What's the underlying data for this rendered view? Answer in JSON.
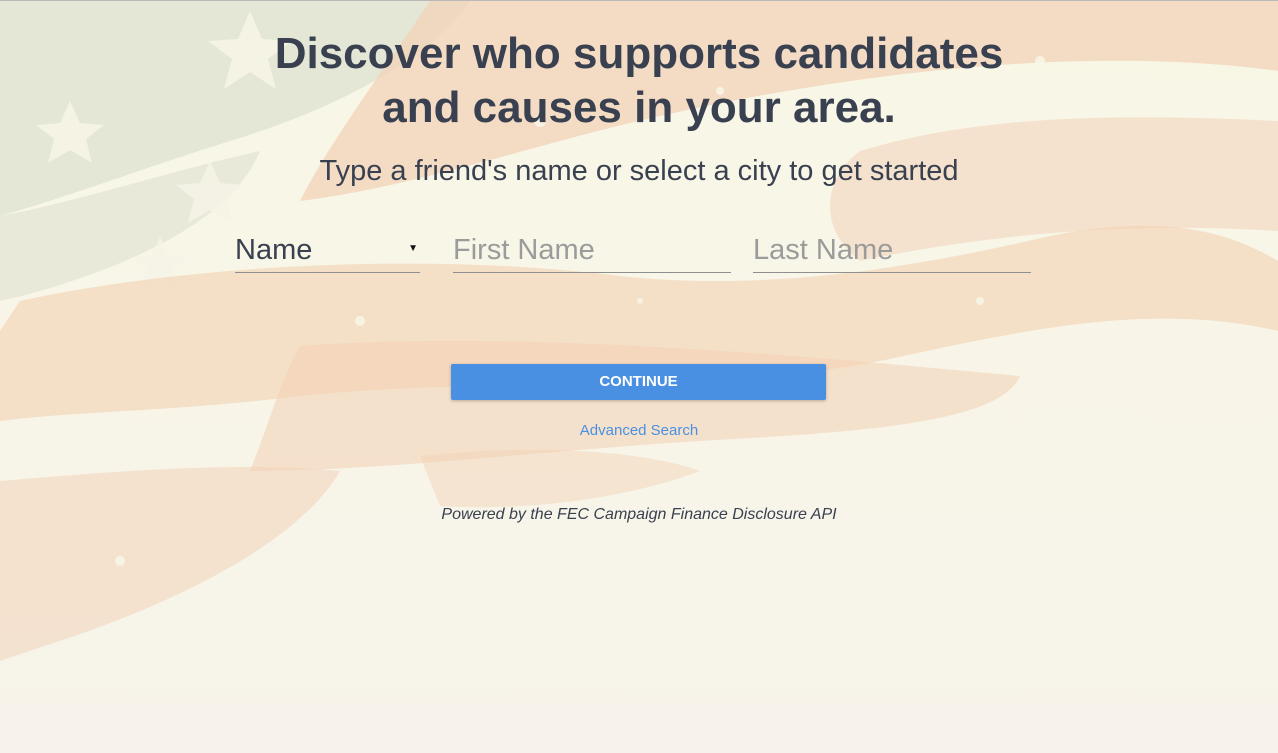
{
  "hero": {
    "headline_line1": "Discover who supports candidates",
    "headline_line2": "and causes in your area.",
    "subheadline": "Type a friend's name or select a city to get started"
  },
  "search_form": {
    "search_type": {
      "selected": "Name",
      "caret_icon": "caret-down-icon"
    },
    "first_name": {
      "value": "",
      "placeholder": "First Name"
    },
    "last_name": {
      "value": "",
      "placeholder": "Last Name"
    },
    "continue_label": "CONTINUE",
    "advanced_search_label": "Advanced Search"
  },
  "footer": {
    "powered_by": "Powered by the FEC Campaign Finance Disclosure API"
  },
  "theme": {
    "text_color": "#39404f",
    "accent_color": "#4a90e2",
    "background_color": "#f7f6e8",
    "flag_stripe_color": "#f2cdb0",
    "flag_canton_color": "#d7dccd",
    "background_icon": "american-flag-watermark"
  }
}
